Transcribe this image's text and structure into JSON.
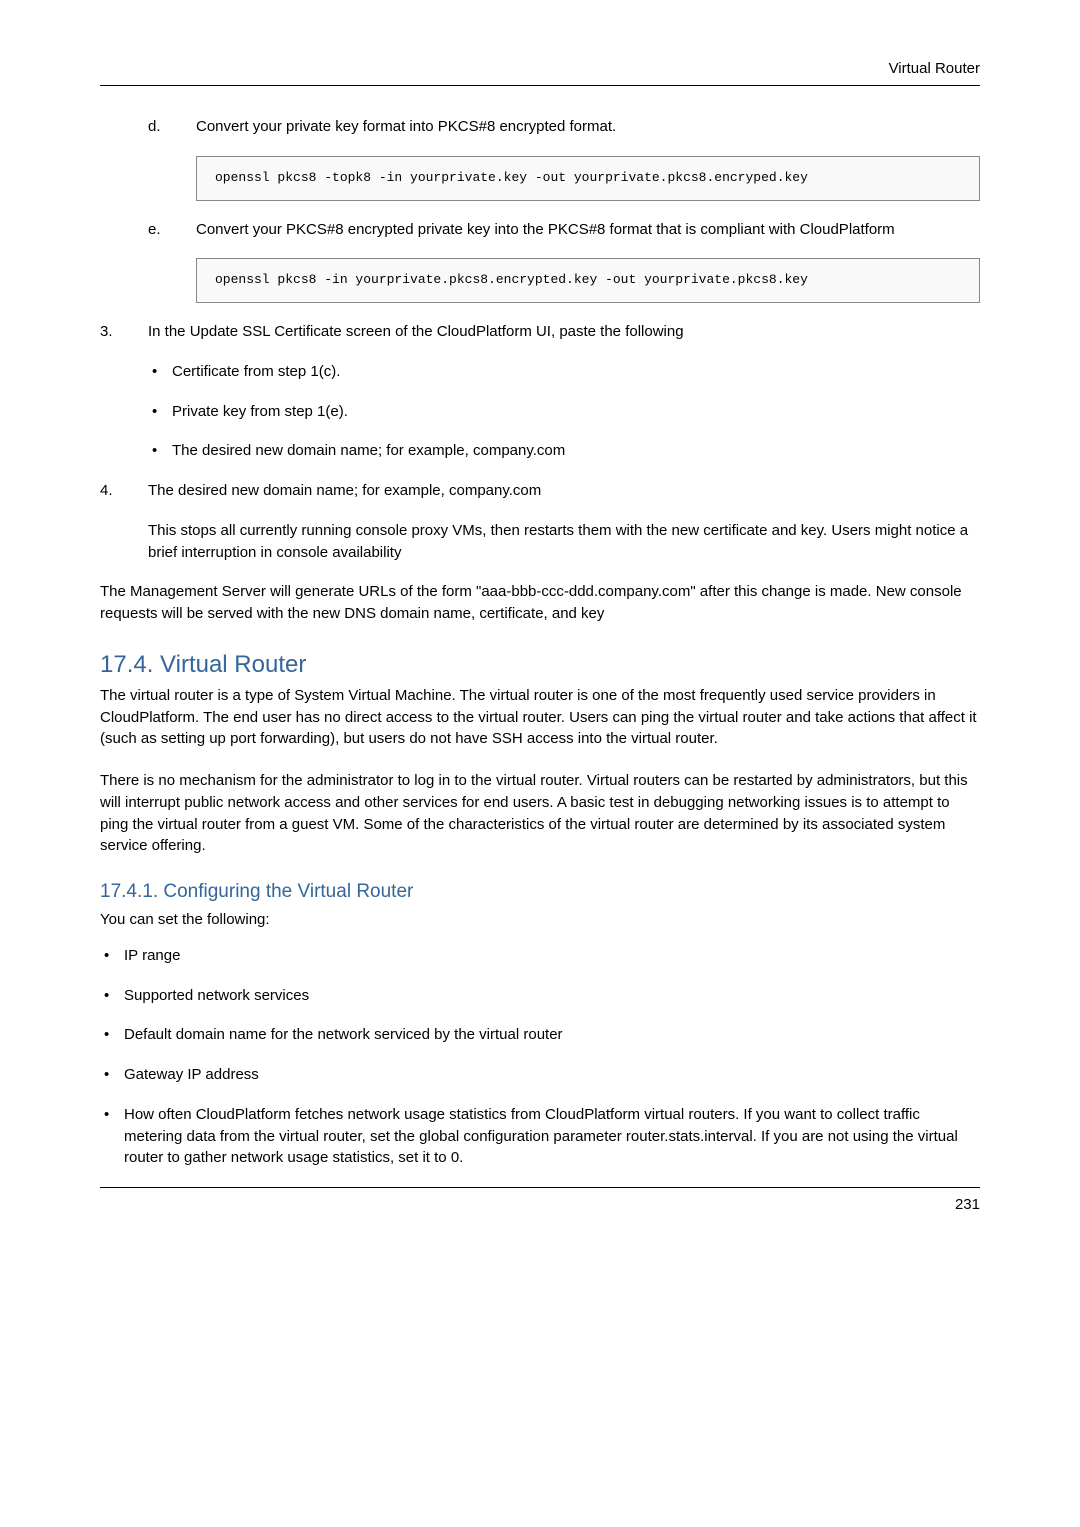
{
  "header": {
    "title": "Virtual Router"
  },
  "steps": {
    "d": {
      "marker": "d.",
      "text": "Convert your private key format into PKCS#8 encrypted format.",
      "code": "openssl pkcs8 -topk8 -in yourprivate.key -out yourprivate.pkcs8.encryped.key"
    },
    "e": {
      "marker": "e.",
      "text": "Convert your PKCS#8 encrypted private key into the PKCS#8 format that is compliant with CloudPlatform",
      "code": "openssl pkcs8 -in yourprivate.pkcs8.encrypted.key -out yourprivate.pkcs8.key"
    },
    "s3": {
      "marker": "3.",
      "text": "In the Update SSL Certificate screen of the CloudPlatform UI, paste the following",
      "bullets": [
        "Certificate from step 1(c).",
        "Private key from step 1(e).",
        "The desired new domain name; for example, company.com"
      ]
    },
    "s4": {
      "marker": "4.",
      "text": "The desired new domain name; for example, company.com",
      "para": "This stops all currently running console proxy VMs, then restarts them with the new certificate and key. Users might notice a brief interruption in console availability"
    }
  },
  "closing_para": "The Management Server will generate URLs of the form \"aaa-bbb-ccc-ddd.company.com\" after this change is made. New console requests will be served with the new DNS domain name, certificate, and key",
  "section_17_4": {
    "title": "17.4. Virtual Router",
    "p1": "The virtual router is a type of System Virtual Machine. The virtual router is one of the most frequently used service providers in CloudPlatform. The end user has no direct access to the virtual router. Users can ping the virtual router and take actions that affect it (such as setting up port forwarding), but users do not have SSH access into the virtual router.",
    "p2": "There is no mechanism for the administrator to log in to the virtual router. Virtual routers can be restarted by administrators, but this will interrupt public network access and other services for end users. A basic test in debugging networking issues is to attempt to ping the virtual router from a guest VM. Some of the characteristics of the virtual router are determined by its associated system service offering."
  },
  "section_17_4_1": {
    "title": "17.4.1. Configuring the Virtual Router",
    "intro": "You can set the following:",
    "bullets": [
      "IP range",
      "Supported network services",
      "Default domain name for the network serviced by the virtual router",
      "Gateway IP address",
      "How often CloudPlatform fetches network usage statistics from CloudPlatform virtual routers. If you want to collect traffic metering data from the virtual router, set the global configuration parameter router.stats.interval. If you are not using the virtual router to gather network usage statistics, set it to 0."
    ]
  },
  "page_number": "231"
}
